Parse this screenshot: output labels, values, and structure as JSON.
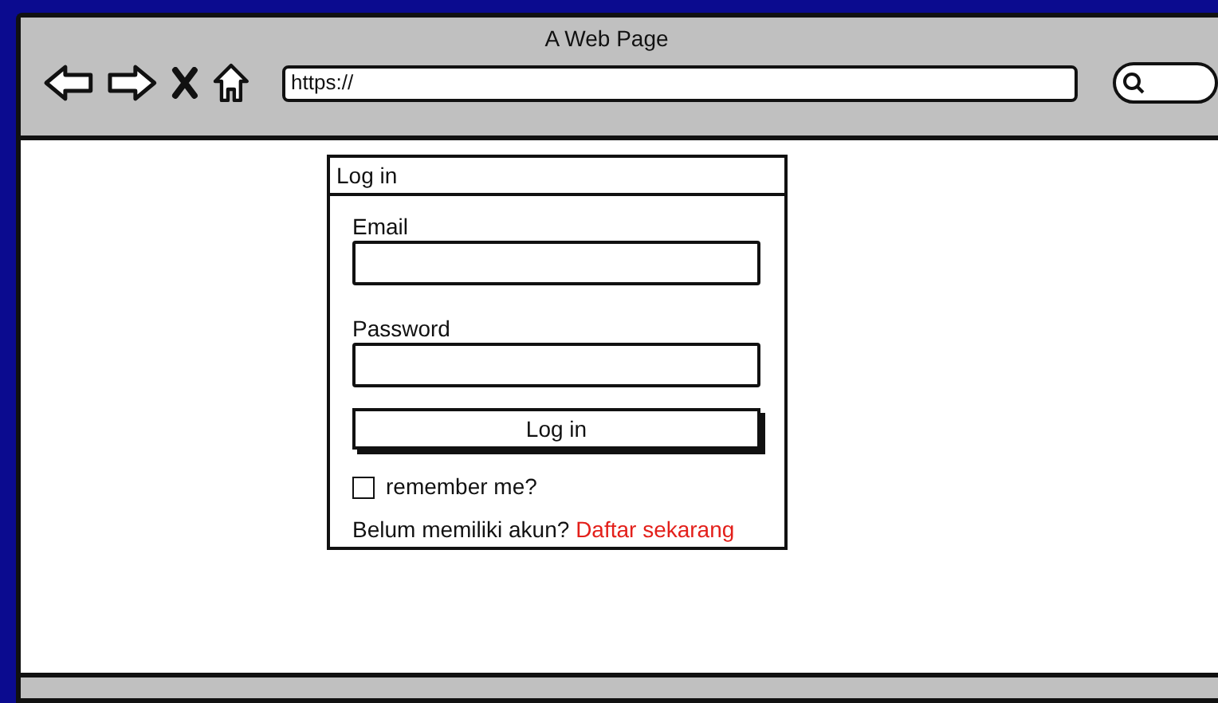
{
  "window": {
    "title": "A Web Page"
  },
  "address_bar": {
    "value": "https://"
  },
  "login_panel": {
    "title": "Log in",
    "fields": [
      {
        "label": "Email"
      },
      {
        "label": "Password"
      }
    ],
    "submit_button": "Log in",
    "remember": {
      "label": "remember me?",
      "checked": false
    },
    "signup": {
      "prompt": "Belum memiliki akun?",
      "link": "Daftar sekarang"
    }
  }
}
